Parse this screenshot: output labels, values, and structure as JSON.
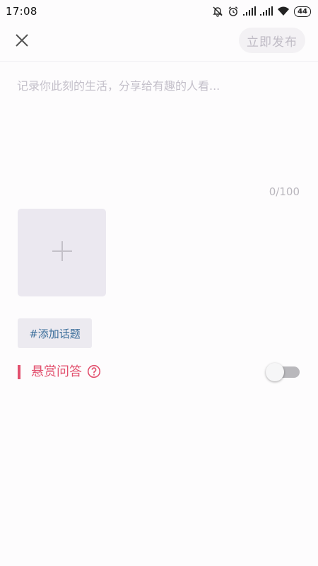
{
  "status_bar": {
    "time": "17:08",
    "battery": "44",
    "icons": [
      "mute-bell-icon",
      "alarm-icon",
      "signal-icon",
      "signal-icon",
      "wifi-icon",
      "battery-icon"
    ]
  },
  "header": {
    "close_icon": "close-icon",
    "publish_label": "立即发布"
  },
  "editor": {
    "value": "",
    "placeholder": "记录你此刻的生活，分享给有趣的人看...",
    "char_count": "0/100"
  },
  "media": {
    "add_icon": "plus-icon"
  },
  "topic": {
    "label": "#添加话题"
  },
  "reward": {
    "label": "悬赏问答",
    "help_icon": "question-circle-icon",
    "enabled": false
  },
  "colors": {
    "accent": "#e2506e",
    "topic_text": "#3a6d9a",
    "publish_disabled_bg": "#f3f1f4",
    "publish_disabled_text": "#c0bcc6",
    "tile_bg": "#ebe8f0"
  }
}
